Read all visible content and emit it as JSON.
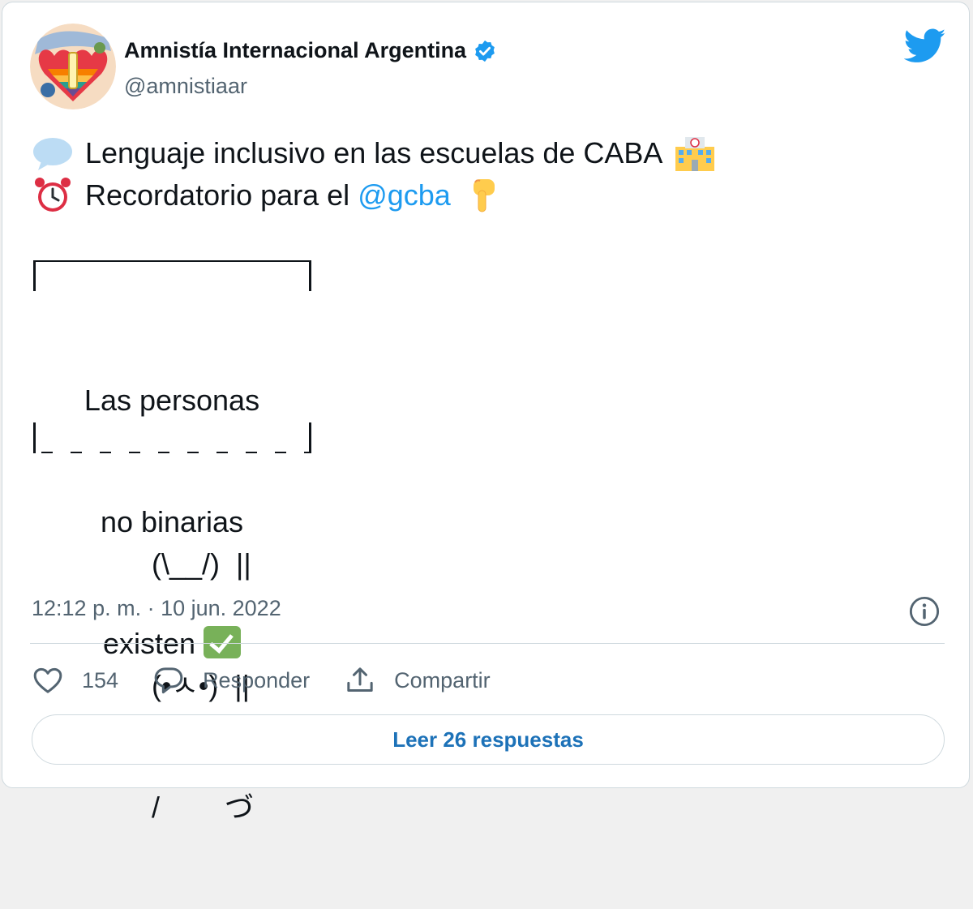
{
  "account": {
    "name": "Amnistía Internacional Argentina",
    "handle": "@amnistiaar"
  },
  "tweet": {
    "line1_text": "Lenguaje inclusivo en las escuelas de CABA",
    "line1_icon": "speech-bubble-icon",
    "line1_end_icon": "school-icon",
    "line2_text": "Recordatorio para el",
    "line2_icon": "alarm-clock-icon",
    "line2_mention": "@gcba",
    "line2_end_icon": "backhand-index-pointing-down-icon",
    "sign_lines": [
      "Las personas",
      "no binarias",
      "existen"
    ],
    "sign_check_icon": "check-mark-button-icon",
    "bunny_lines": [
      "(\\__/)  ||",
      "(•ㅅ•)  ||",
      "/        づ"
    ]
  },
  "timestamp": "12:12 p. m. · 10 jun. 2022",
  "actions": {
    "likes": "154",
    "reply_label": "Responder",
    "share_label": "Compartir"
  },
  "read_replies_label": "Leer 26 respuestas",
  "colors": {
    "accent": "#1d9bf0",
    "text": "#0f1419",
    "muted": "#536471",
    "border": "#cfd9de",
    "check_green": "#78b159"
  }
}
